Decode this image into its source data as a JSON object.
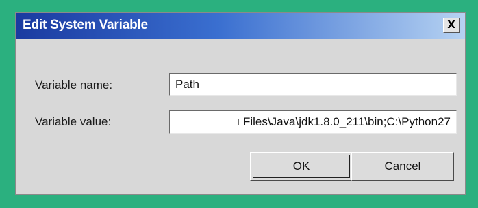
{
  "window": {
    "title": "Edit System Variable",
    "close_glyph": "X"
  },
  "form": {
    "name_label": "Variable name:",
    "name_value": "Path",
    "value_label": "Variable value:",
    "value_value": "ı Files\\Java\\jdk1.8.0_211\\bin;C:\\Python27"
  },
  "buttons": {
    "ok_label": "OK",
    "cancel_label": "Cancel"
  },
  "colors": {
    "background": "#2bb07f",
    "titlebar_start": "#1a3aa0",
    "titlebar_end": "#b6d2f2"
  },
  "icons": {
    "close": "close-icon"
  }
}
